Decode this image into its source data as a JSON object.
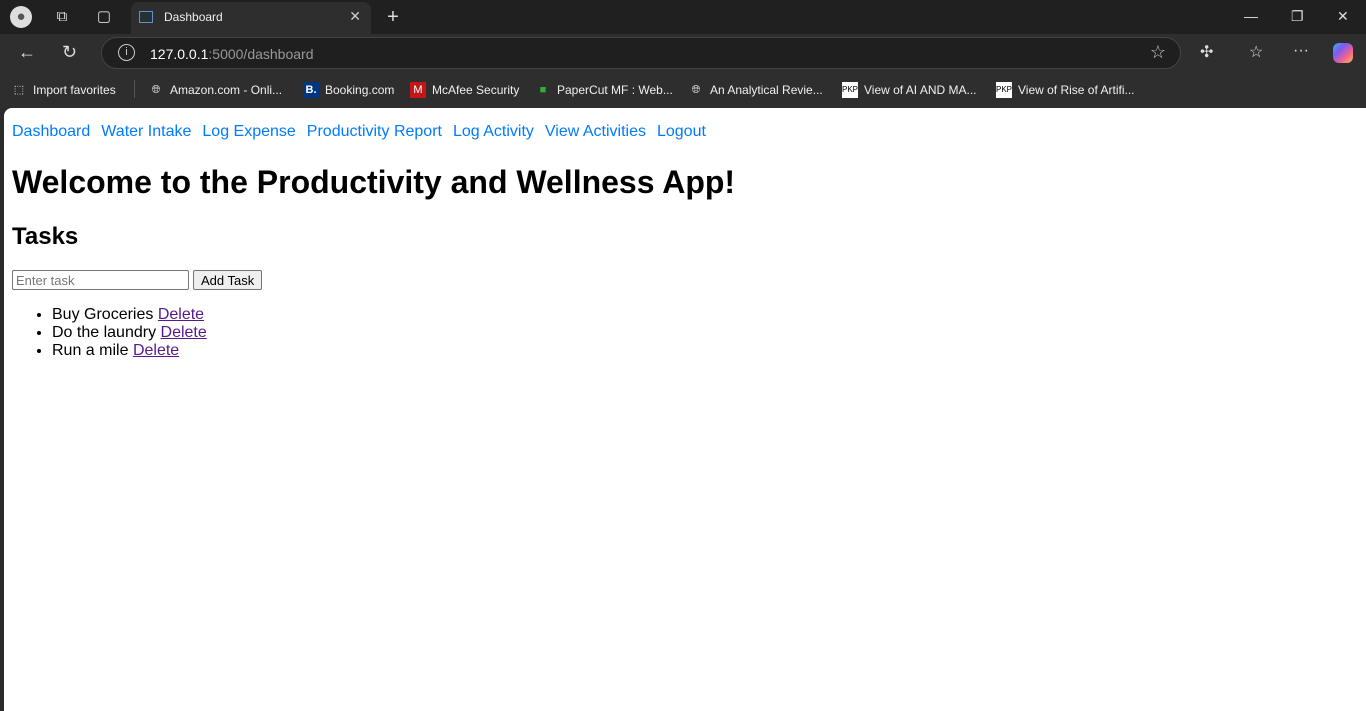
{
  "browser": {
    "tab_title": "Dashboard",
    "url_host": "127.0.0.1",
    "url_path": ":5000/dashboard",
    "bookmarks": [
      "Import favorites",
      "Amazon.com - Onli...",
      "Booking.com",
      "McAfee Security",
      "PaperCut MF : Web...",
      "An Analytical Revie...",
      "View of AI AND MA...",
      "View of Rise of Artifi..."
    ]
  },
  "nav": {
    "links": [
      "Dashboard",
      "Water Intake",
      "Log Expense",
      "Productivity Report",
      "Log Activity",
      "View Activities",
      "Logout"
    ]
  },
  "heading": "Welcome to the Productivity and Wellness App!",
  "tasks": {
    "title": "Tasks",
    "input_placeholder": "Enter task",
    "input_value": "",
    "add_label": "Add Task",
    "items": [
      {
        "text": "Buy Groceries",
        "delete_label": "Delete"
      },
      {
        "text": "Do the laundry",
        "delete_label": "Delete"
      },
      {
        "text": "Run a mile",
        "delete_label": "Delete"
      }
    ]
  },
  "colors": {
    "link": "#007bff",
    "visited_link": "#551a8b"
  }
}
